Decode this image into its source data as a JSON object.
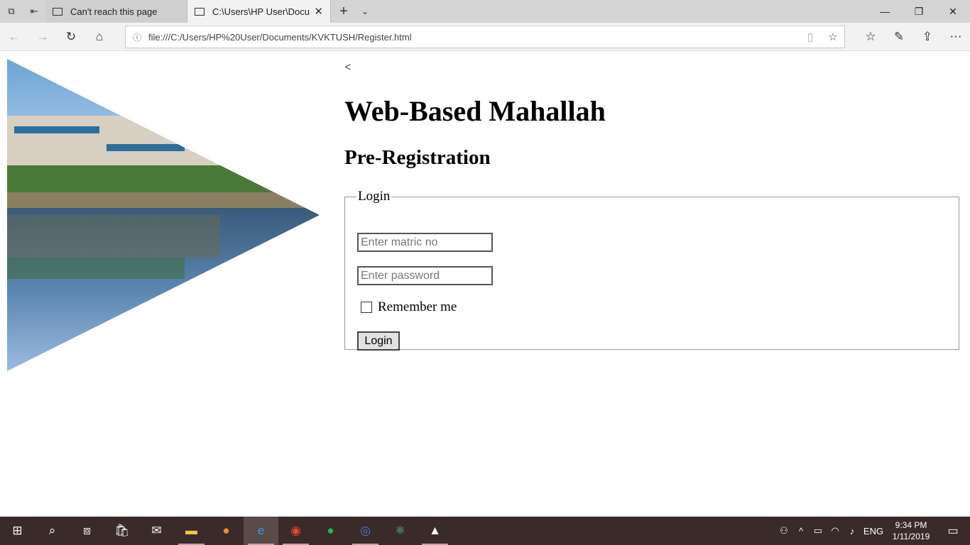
{
  "browser": {
    "tabs": [
      {
        "label": "Can't reach this page",
        "active": false
      },
      {
        "label": "C:\\Users\\HP User\\Docu",
        "active": true
      }
    ],
    "address": "file:///C:/Users/HP%20User/Documents/KVKTUSH/Register.html"
  },
  "page": {
    "back_link": "<",
    "title": "Web-Based Mahallah",
    "subtitle": "Pre-Registration",
    "form": {
      "legend": "Login",
      "matric_placeholder": "Enter matric no",
      "password_placeholder": "Enter password",
      "remember_label": "Remember me",
      "remember_checked": false,
      "login_button": "Login"
    }
  },
  "taskbar": {
    "language": "ENG",
    "time": "9:34 PM",
    "date": "1/11/2019"
  }
}
